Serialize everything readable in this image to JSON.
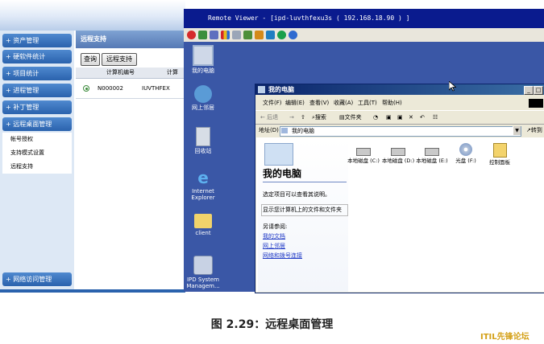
{
  "app": {
    "nav": [
      {
        "label": "资产管理",
        "type": "head"
      },
      {
        "label": "硬软件统计",
        "type": "head"
      },
      {
        "label": "项目统计",
        "type": "head"
      },
      {
        "label": "进程管理",
        "type": "head"
      },
      {
        "label": "补丁管理",
        "type": "head"
      },
      {
        "label": "远程桌面管理",
        "type": "head"
      },
      {
        "label": "帐号授权",
        "type": "sub"
      },
      {
        "label": "支持模式设置",
        "type": "sub"
      },
      {
        "label": "远程支持",
        "type": "sub"
      },
      {
        "label": "网络访问管理",
        "type": "head"
      }
    ],
    "nav_prefix": "+",
    "content_header": "远程支持",
    "buttons": {
      "query": "查询",
      "remote_support": "远程支持"
    },
    "grid": {
      "columns": [
        "计算机编号",
        "计算"
      ],
      "row": {
        "id": "N000002",
        "name": "IUVTHFEX"
      }
    }
  },
  "remote_viewer": {
    "title": "Remote Viewer - [ipd-luvthfexu3s ( 192.168.18.90 ) ]",
    "desktop_icons": [
      "我的电脑",
      "网上邻居",
      "回收站",
      "Internet\nExplorer",
      "client",
      "IPD System\nManagem..."
    ]
  },
  "window": {
    "title": "我的电脑",
    "controls": {
      "minimize": "_",
      "maximize": "□"
    },
    "menu": [
      "文件(F)",
      "编辑(E)",
      "查看(V)",
      "收藏(A)",
      "工具(T)",
      "帮助(H)"
    ],
    "toolbar": {
      "back": "后退",
      "search": "搜索",
      "folders": "文件夹"
    },
    "address_label": "地址(D)",
    "address_value": "我的电脑",
    "go_label": "转到",
    "pane_title": "我的电脑",
    "pane_hint": "选定项目可以查看其说明。",
    "pane_selected": "显示您计算机上的文件和文件夹",
    "see_also": "另请参阅:",
    "links": [
      "我的文档",
      "网上邻居",
      "网络和拨号连接"
    ],
    "drives": [
      "本地磁盘 (C:)",
      "本地磁盘 (D:)",
      "本地磁盘 (E:)",
      "光盘 (F:)",
      "控制面板"
    ]
  },
  "caption": "图 2.29：远程桌面管理",
  "watermark": "ITIL先锋论坛",
  "colors": {
    "nav_blue": "#2a62ad",
    "desktop_blue": "#3a57a6",
    "viewer_titlebar": "#0a1b8e"
  }
}
